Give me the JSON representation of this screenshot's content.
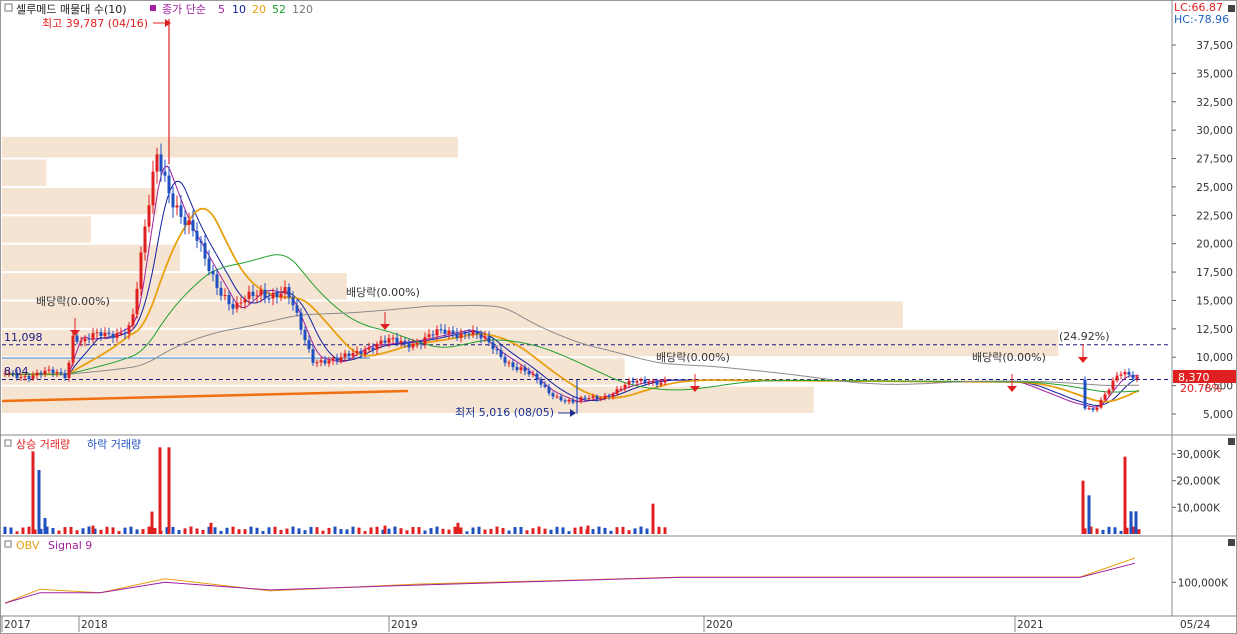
{
  "header": {
    "legend_main": "셀루메드 매물대 수(10)",
    "legend_ma_prefix": "종가 단순",
    "ma_periods": [
      "5",
      "10",
      "20",
      "52",
      "120"
    ],
    "ma_colors": [
      "#a020a0",
      "#1020a0",
      "#e8a010",
      "#20a030",
      "#8a8a8a"
    ],
    "lc_label": "LC:66.87",
    "hc_label": "HC:-78.96"
  },
  "annotations": {
    "high": "최고 39,787 (04/16)",
    "low": "최저 5,016 (08/05)",
    "dividends": [
      "배당락(0.00%)",
      "배당락(0.00%)",
      "배당락(0.00%)",
      "배당락(0.00%)"
    ],
    "ref_high": "11,098",
    "ref_low": "8,04",
    "pct_top": "(24.92%)",
    "pct_bottom": "20.78%",
    "current_price": "8,370"
  },
  "volume_panel": {
    "up_label": "상승 거래량",
    "down_label": "하락 거래량"
  },
  "obv_panel": {
    "obv_label": "OBV",
    "signal_label": "Signal 9"
  },
  "x_axis": {
    "labels": [
      "2017",
      "2018",
      "2019",
      "2020",
      "2021",
      "05/24"
    ]
  },
  "chart_data": [
    {
      "type": "candlestick",
      "title": "셀루메드 매물대 수(10)",
      "ylim": [
        2500,
        40500
      ],
      "y_ticks": [
        "5,000",
        "7,500",
        "10,000",
        "12,500",
        "15,000",
        "17,500",
        "20,000",
        "22,500",
        "25,000",
        "27,500",
        "30,000",
        "32,500",
        "35,000",
        "37,500"
      ],
      "x_ticks": [
        "2017",
        "2018",
        "2019",
        "2020",
        "2021",
        "05/24"
      ],
      "high": 39787,
      "low": 5016,
      "last": 8370,
      "ref_lines": [
        11098,
        8040
      ],
      "close_path": [
        [
          "2017-11",
          8500
        ],
        [
          "2017-12",
          12500
        ],
        [
          "2018-01",
          11500
        ],
        [
          "2018-02",
          11800
        ],
        [
          "2018-03",
          13000
        ],
        [
          "2018-04",
          28000
        ],
        [
          "2018-05",
          22000
        ],
        [
          "2018-06",
          18000
        ],
        [
          "2018-07",
          14000
        ],
        [
          "2018-08",
          16000
        ],
        [
          "2018-09",
          15500
        ],
        [
          "2018-10",
          10000
        ],
        [
          "2018-11",
          9500
        ],
        [
          "2018-12",
          11000
        ],
        [
          "2019-01",
          11200
        ],
        [
          "2019-02",
          11500
        ],
        [
          "2019-03",
          12000
        ],
        [
          "2019-04",
          12500
        ],
        [
          "2019-05",
          10500
        ],
        [
          "2019-06",
          9000
        ],
        [
          "2019-07",
          7000
        ],
        [
          "2019-08",
          6000
        ],
        [
          "2019-09",
          6500
        ],
        [
          "2019-10",
          7500
        ],
        [
          "2019-11",
          8000
        ],
        [
          "2021-01",
          7800
        ],
        [
          "2021-03",
          6000
        ],
        [
          "2021-04",
          5500
        ],
        [
          "2021-05",
          8370
        ]
      ],
      "volume_profile": [
        {
          "price_from": 27500,
          "price_to": 29500,
          "volume_rel": 0.41
        },
        {
          "price_from": 25000,
          "price_to": 27500,
          "volume_rel": 0.04
        },
        {
          "price_from": 22500,
          "price_to": 25000,
          "volume_rel": 0.14
        },
        {
          "price_from": 20000,
          "price_to": 22500,
          "volume_rel": 0.08
        },
        {
          "price_from": 17500,
          "price_to": 20000,
          "volume_rel": 0.16
        },
        {
          "price_from": 15000,
          "price_to": 17500,
          "volume_rel": 0.31
        },
        {
          "price_from": 12500,
          "price_to": 15000,
          "volume_rel": 0.81
        },
        {
          "price_from": 10000,
          "price_to": 12500,
          "volume_rel": 0.95
        },
        {
          "price_from": 7500,
          "price_to": 10000,
          "volume_rel": 0.56
        },
        {
          "price_from": 5000,
          "price_to": 7500,
          "volume_rel": 0.73
        }
      ]
    },
    {
      "type": "bar",
      "title": "상승 거래량 / 하락 거래량",
      "ylim": [
        0,
        37000
      ],
      "y_ticks": [
        "10,000K",
        "20,000K",
        "30,000K"
      ],
      "series": [
        {
          "name": "상승 거래량",
          "values": [
            31000,
            15000,
            32500,
            12000,
            9000,
            24000,
            20000,
            29000
          ]
        },
        {
          "name": "하락 거래량",
          "values": [
            24000,
            6000,
            7000,
            4000,
            3000,
            7000,
            14500,
            8500
          ]
        }
      ]
    },
    {
      "type": "line",
      "title": "OBV / Signal 9",
      "y_ticks": [
        "100,000K"
      ],
      "series": [
        {
          "name": "OBV",
          "values": [
            40000,
            80000,
            70000,
            110000,
            75000,
            95000,
            105000,
            115000,
            115000,
            115000,
            170000
          ]
        },
        {
          "name": "Signal 9",
          "values": [
            40000,
            70000,
            70000,
            100000,
            78000,
            92000,
            104000,
            114000,
            114000,
            114000,
            155000
          ]
        }
      ]
    }
  ]
}
